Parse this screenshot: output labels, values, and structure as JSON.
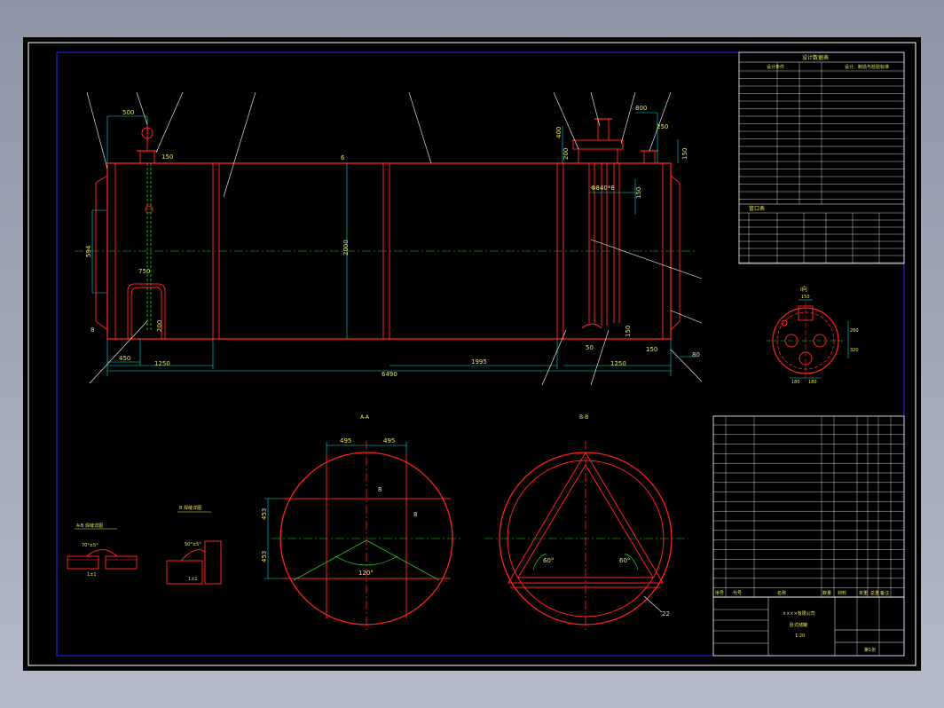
{
  "colors": {
    "background": "#000000",
    "frame": "#ffffff",
    "border": "#2a2aff",
    "vessel": "#ff2020",
    "dimension": "#00e0e0",
    "text": "#e8e85a",
    "centerline": "#20d020",
    "leader": "#ffffff"
  },
  "main_view": {
    "dims": {
      "d500": "500",
      "d150a": "150",
      "d594": "594",
      "d750": "750",
      "d200": "200",
      "d8": "8",
      "d450": "450",
      "d1250a": "1250",
      "d1995": "1995",
      "d1250b": "1250",
      "d6490": "6490",
      "d2000": "2000",
      "d6": "6",
      "d400": "400",
      "d200b": "200",
      "d800": "800",
      "d250": "250",
      "d150b": "150",
      "d1040": "Φ840*8",
      "d150c": "150",
      "d50": "50",
      "d150d": "150",
      "d150e": "150",
      "d80": "80"
    }
  },
  "section_a": {
    "title": "A-A",
    "dims": {
      "d495a": "495",
      "d495b": "495",
      "d453a": "453",
      "d453b": "453",
      "d8a": "8",
      "d8b": "8",
      "angle": "120°"
    }
  },
  "section_b": {
    "title": "B-B",
    "dims": {
      "ang1": "60°",
      "ang2": "60°",
      "leader": "22"
    }
  },
  "top_detail": {
    "title": "I向",
    "dims": {
      "d150": "150",
      "d180a": "180",
      "d180b": "180",
      "d260": "260",
      "d320": "320"
    }
  },
  "weld_details": {
    "left_title": "A-B 焊缝详图",
    "left_angle": "70°±5°",
    "left_dim": "1±1",
    "right_title": "B 焊缝详图",
    "right_angle": "50°±5°",
    "right_dim": "1±1"
  },
  "design_table": {
    "title": "设计数据表",
    "header_left": "设计条件",
    "header_right": "设计、制造与检验标准"
  },
  "nozzle_table": {
    "title": "管口表"
  },
  "parts_list": {
    "header": [
      "序号",
      "代号",
      "名称",
      "数量",
      "材料",
      "单重",
      "总重",
      "备注"
    ]
  },
  "title_block": {
    "name": "××××有限公司",
    "drawing": "卧式储罐",
    "scale": "1:20",
    "sheet": "第1张"
  }
}
